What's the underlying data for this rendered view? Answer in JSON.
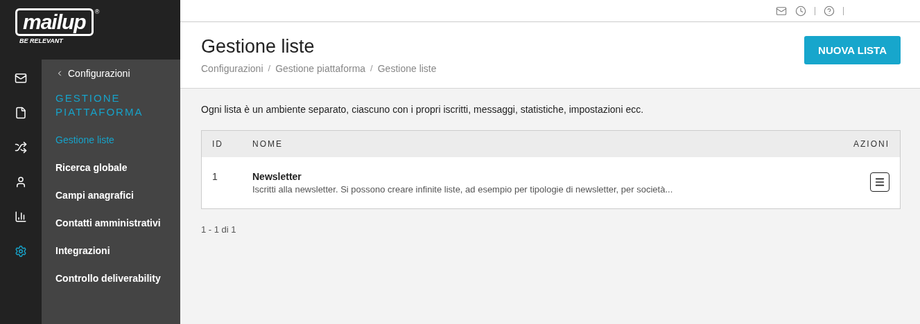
{
  "logo": {
    "name": "mailup",
    "mark": "®",
    "tagline": "BE RELEVANT"
  },
  "rail": [
    {
      "selected": false
    },
    {
      "selected": false
    },
    {
      "selected": false
    },
    {
      "selected": false
    },
    {
      "selected": false
    },
    {
      "selected": true
    }
  ],
  "submenu": {
    "back": "Configurazioni",
    "section": "GESTIONE PIATTAFORMA",
    "items": [
      {
        "label": "Gestione liste",
        "selected": true
      },
      {
        "label": "Ricerca globale",
        "selected": false
      },
      {
        "label": "Campi anagrafici",
        "selected": false
      },
      {
        "label": "Contatti amministrativi",
        "selected": false
      },
      {
        "label": "Integrazioni",
        "selected": false
      },
      {
        "label": "Controllo deliverability",
        "selected": false
      }
    ]
  },
  "page": {
    "title": "Gestione liste",
    "breadcrumb": [
      {
        "kind": "link",
        "label": "Configurazioni"
      },
      {
        "kind": "separator",
        "label": "/"
      },
      {
        "kind": "link",
        "label": "Gestione piattaforma"
      },
      {
        "kind": "separator",
        "label": "/"
      },
      {
        "kind": "link",
        "label": "Gestione liste"
      }
    ],
    "action": "NUOVA LISTA"
  },
  "intro": "Ogni lista è un ambiente separato, ciascuno con i propri iscritti, messaggi, statistiche, impostazioni ecc.",
  "table": {
    "columns": [
      "ID",
      "NOME",
      "AZIONI"
    ],
    "rows": [
      {
        "id": "1",
        "name": "Newsletter",
        "description": "Iscritti alla newsletter. Si possono creare infinite liste, ad esempio per tipologie di newsletter, per società..."
      }
    ]
  },
  "pagination": "1 - 1 di 1"
}
